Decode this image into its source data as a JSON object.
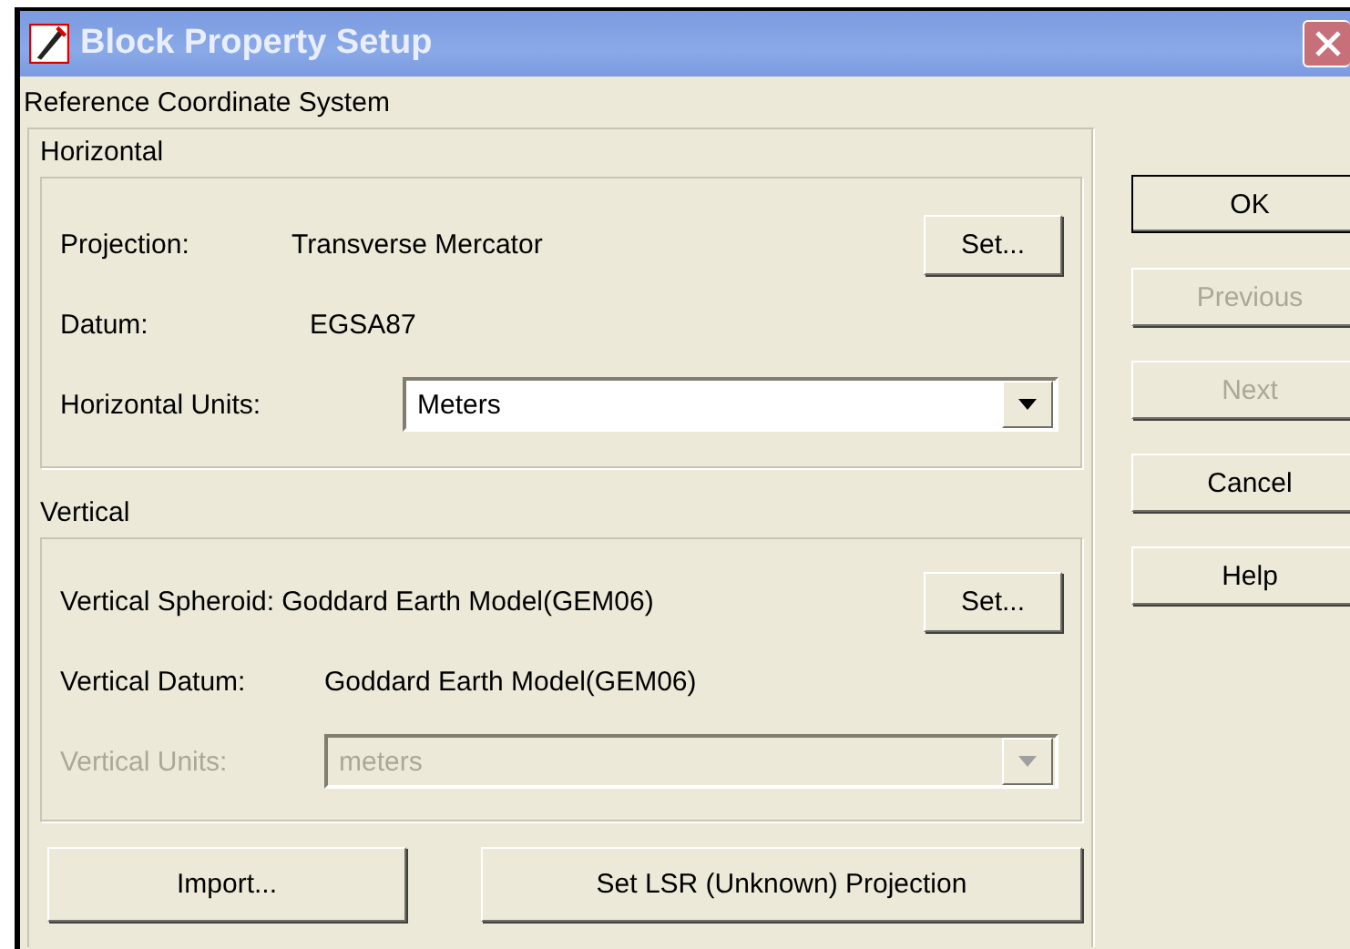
{
  "window": {
    "title": "Block Property Setup"
  },
  "group_title": "Reference Coordinate System",
  "horizontal": {
    "title": "Horizontal",
    "projection": {
      "label": "Projection:",
      "value": "Transverse Mercator",
      "button": "Set..."
    },
    "datum": {
      "label": "Datum:",
      "value": "EGSA87"
    },
    "units": {
      "label": "Horizontal Units:",
      "value": "Meters",
      "disabled": false
    }
  },
  "vertical": {
    "title": "Vertical",
    "spheroid": {
      "label": "Vertical Spheroid:",
      "value": "Goddard Earth Model(GEM06)",
      "button": "Set..."
    },
    "datum": {
      "label": "Vertical Datum:",
      "value": "Goddard Earth Model(GEM06)"
    },
    "units": {
      "label": "Vertical Units:",
      "value": "meters",
      "disabled": true
    }
  },
  "bottom_buttons": [
    "Import...",
    "Set LSR (Unknown) Projection"
  ],
  "side_buttons": [
    {
      "label": "OK",
      "disabled": false,
      "default": true
    },
    {
      "label": "Previous",
      "disabled": true,
      "default": false
    },
    {
      "label": "Next",
      "disabled": true,
      "default": false
    },
    {
      "label": "Cancel",
      "disabled": false,
      "default": false
    },
    {
      "label": "Help",
      "disabled": false,
      "default": false
    }
  ]
}
